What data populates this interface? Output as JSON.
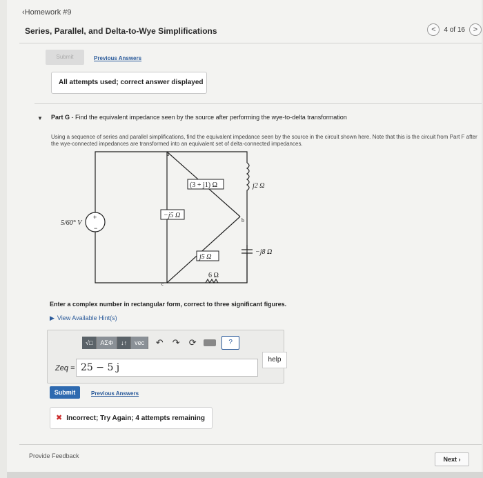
{
  "nav": {
    "back_label": "‹Homework #9"
  },
  "header": {
    "title": "Series, Parallel, and Delta-to-Wye Simplifications",
    "prev_arrow": "<",
    "pagination": "4 of 16",
    "next_arrow": ">"
  },
  "previous_part": {
    "faded_button": "Submit",
    "previous_answers": "Previous Answers",
    "status": "All attempts used; correct answer displayed"
  },
  "part": {
    "label": "Part G",
    "title": "Find the equivalent impedance seen by the source after performing the wye-to-delta transformation",
    "description": "Using a sequence of series and parallel simplifications, find the equivalent impedance seen by the source in the circuit shown here. Note that this is the circuit from Part F after the wye-connected impedances are transformed into an equivalent set of delta-connected impedances."
  },
  "circuit": {
    "source": "5/60° V",
    "node_a": "a",
    "node_b": "b",
    "node_c": "c",
    "z_top": "(3 + j1) Ω",
    "z_j2": "j2 Ω",
    "z_m5": "−j5 Ω",
    "z_j5": "j5 Ω",
    "z_m8": "−j8 Ω",
    "z_6": "6 Ω"
  },
  "instructions": "Enter a complex number in rectangular form, correct to three significant figures.",
  "hint_link": "View Available Hint(s)",
  "toolbar": {
    "templates": "√□",
    "greek": "AΣΦ",
    "arrows": "↓↑",
    "vec": "vec",
    "help_q": "?",
    "help_label": "help"
  },
  "answer": {
    "label": "Zeq =",
    "value": "25 − 5 j"
  },
  "actions": {
    "submit": "Submit",
    "previous_answers": "Previous Answers"
  },
  "feedback": {
    "icon": "✖",
    "text": "Incorrect; Try Again; 4 attempts remaining"
  },
  "footer": {
    "provide_feedback": "Provide Feedback",
    "next": "Next ›"
  }
}
